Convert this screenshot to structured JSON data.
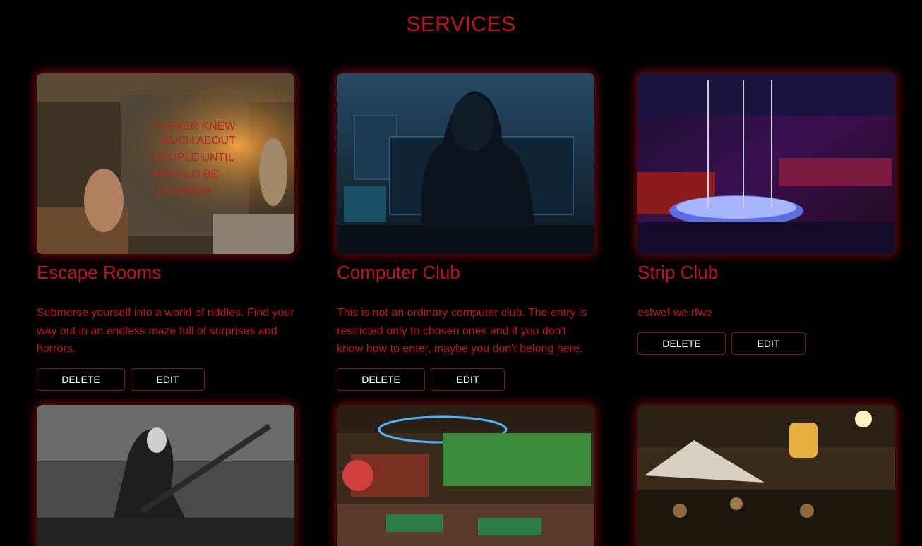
{
  "page": {
    "title": "SERVICES"
  },
  "services": [
    {
      "title": "Escape Rooms",
      "description": "Submerse yourself into a world of riddles. Find your way out in an endless maze full of surprises and horrors.",
      "delete_label": "DELETE",
      "edit_label": "EDIT",
      "image": "escape-room-photo"
    },
    {
      "title": "Computer Club",
      "description": "This is not an ordinary computer club. The entry is restricted only to chosen ones and if you don't know how to enter, maybe you don't belong here.",
      "delete_label": "DELETE",
      "edit_label": "EDIT",
      "image": "hooded-hacker-photo"
    },
    {
      "title": "Strip Club",
      "description": "esfwef we rfwe",
      "delete_label": "DELETE",
      "edit_label": "EDIT",
      "image": "neon-club-photo"
    },
    {
      "image": "skeleton-guitarist-artwork"
    },
    {
      "image": "sports-casino-photo"
    },
    {
      "image": "night-market-artwork"
    }
  ],
  "colors": {
    "accent": "#c8101c",
    "background": "#000000",
    "button_text": "#ffffff"
  }
}
